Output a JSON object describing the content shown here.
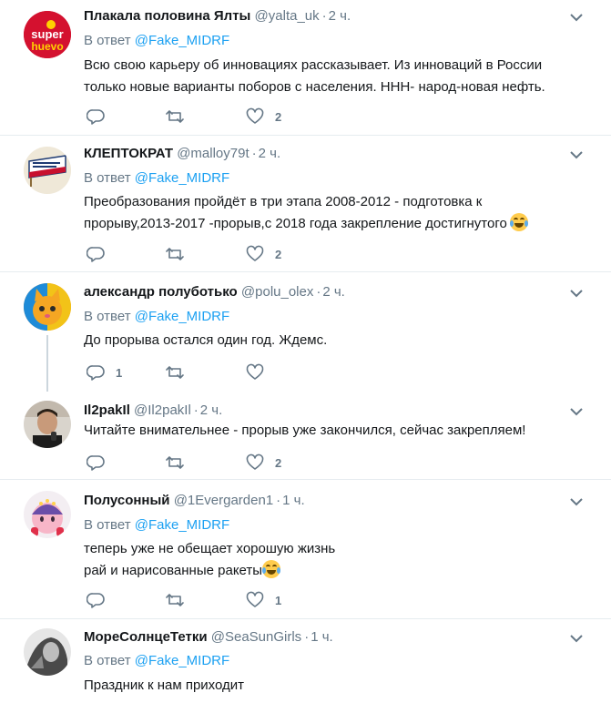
{
  "tweets": [
    {
      "name": "Плакала половина Ялты",
      "handle": "@yalta_uk",
      "time": "2 ч.",
      "reply_prefix": "В ответ",
      "reply_mention": "@Fake_MIDRF",
      "text_lines": [
        "Всю свою карьеру об инновациях рассказывает. Из инноваций в России",
        "только новые варианты поборов с населения. ННН- народ-новая нефть."
      ],
      "reply_count": "",
      "retweet_count": "",
      "like_count": "2",
      "avatar_text": "super huevo"
    },
    {
      "name": "КЛЕПТОКРАТ",
      "handle": "@malloy79t",
      "time": "2 ч.",
      "reply_prefix": "В ответ",
      "reply_mention": "@Fake_MIDRF",
      "text_lines": [
        "Преобразования пройдёт в три этапа 2008-2012 - подготовка к",
        "прорыву,2013-2017 -прорыв,с 2018 года закрепление достигнутого"
      ],
      "reply_count": "",
      "retweet_count": "",
      "like_count": "2"
    },
    {
      "name": "александр полуботько",
      "handle": "@polu_olex",
      "time": "2 ч.",
      "reply_prefix": "В ответ",
      "reply_mention": "@Fake_MIDRF",
      "text_lines": [
        "До прорыва остался один год. Ждемс."
      ],
      "reply_count": "1",
      "retweet_count": "",
      "like_count": ""
    },
    {
      "name": "Il2pakIl",
      "handle": "@Il2pakIl",
      "time": "2 ч.",
      "text_lines": [
        "Читайте внимательнее - прорыв уже закончился, сейчас закрепляем!"
      ],
      "reply_count": "",
      "retweet_count": "",
      "like_count": "2"
    },
    {
      "name": "Полусонный",
      "handle": "@1Evergarden1",
      "time": "1 ч.",
      "reply_prefix": "В ответ",
      "reply_mention": "@Fake_MIDRF",
      "text_lines": [
        "теперь уже не обещает хорошую жизнь",
        "рай и нарисованные ракеты"
      ],
      "reply_count": "",
      "retweet_count": "",
      "like_count": "1"
    },
    {
      "name": "МореСолнцеТетки",
      "handle": "@SeaSunGirls",
      "time": "1 ч.",
      "reply_prefix": "В ответ",
      "reply_mention": "@Fake_MIDRF",
      "text_lines": [
        "Праздник к нам приходит"
      ]
    }
  ],
  "colors": {
    "name": "#14171a",
    "secondary": "#657786",
    "link": "#1da1f2",
    "divider": "#e6ecf0",
    "thread_line": "#ccd6dd"
  },
  "icons": {
    "reply": "reply-icon",
    "retweet": "retweet-icon",
    "like": "heart-icon",
    "more": "chevron-down-icon",
    "emoji": "tears-of-joy-emoji"
  }
}
